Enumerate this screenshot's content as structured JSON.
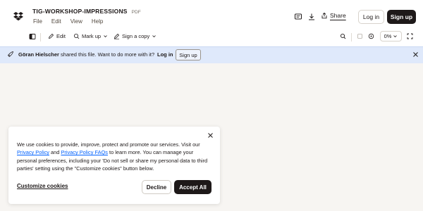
{
  "header": {
    "file_title": "TIG-WORKSHOP-IMPRESSIONS",
    "file_type": "PDF",
    "menu": [
      "File",
      "Edit",
      "View",
      "Help"
    ],
    "share_label": "Share",
    "login_label": "Log in",
    "signup_label": "Sign up"
  },
  "toolbar": {
    "edit_label": "Edit",
    "markup_label": "Mark up",
    "sign_label": "Sign a copy",
    "zoom_value": "0%"
  },
  "banner": {
    "user_name": "Göran Hielscher",
    "message": " shared this file. Want to do more with it?",
    "login_label": "Log in",
    "signup_label": "Sign up"
  },
  "cookie": {
    "text_1": "We use cookies to provide, improve, protect and promote our services. Visit our ",
    "privacy_policy": "Privacy Policy",
    "text_2": " and ",
    "privacy_faqs": "Privacy Policy FAQs",
    "text_3": " to learn more. You can manage your personal preferences, including your 'Do not sell or share my personal data to third parties' setting using the \"Customize cookies\" button below.",
    "customize_label": "Customize cookies",
    "decline_label": "Decline",
    "accept_label": "Accept All"
  },
  "colors": {
    "accent_dark": "#1e1919",
    "banner_bg": "#dfe9fb",
    "link_blue": "#0061fe",
    "canvas_bg": "#f7f5f2"
  },
  "icons": [
    "dropbox-logo-icon",
    "comment-icon",
    "download-icon",
    "share-icon",
    "sidebar-toggle-icon",
    "pencil-icon",
    "markup-icon",
    "sign-icon",
    "search-icon",
    "page-icon",
    "zoom-in-icon",
    "fullscreen-icon",
    "rocket-icon",
    "close-icon"
  ]
}
